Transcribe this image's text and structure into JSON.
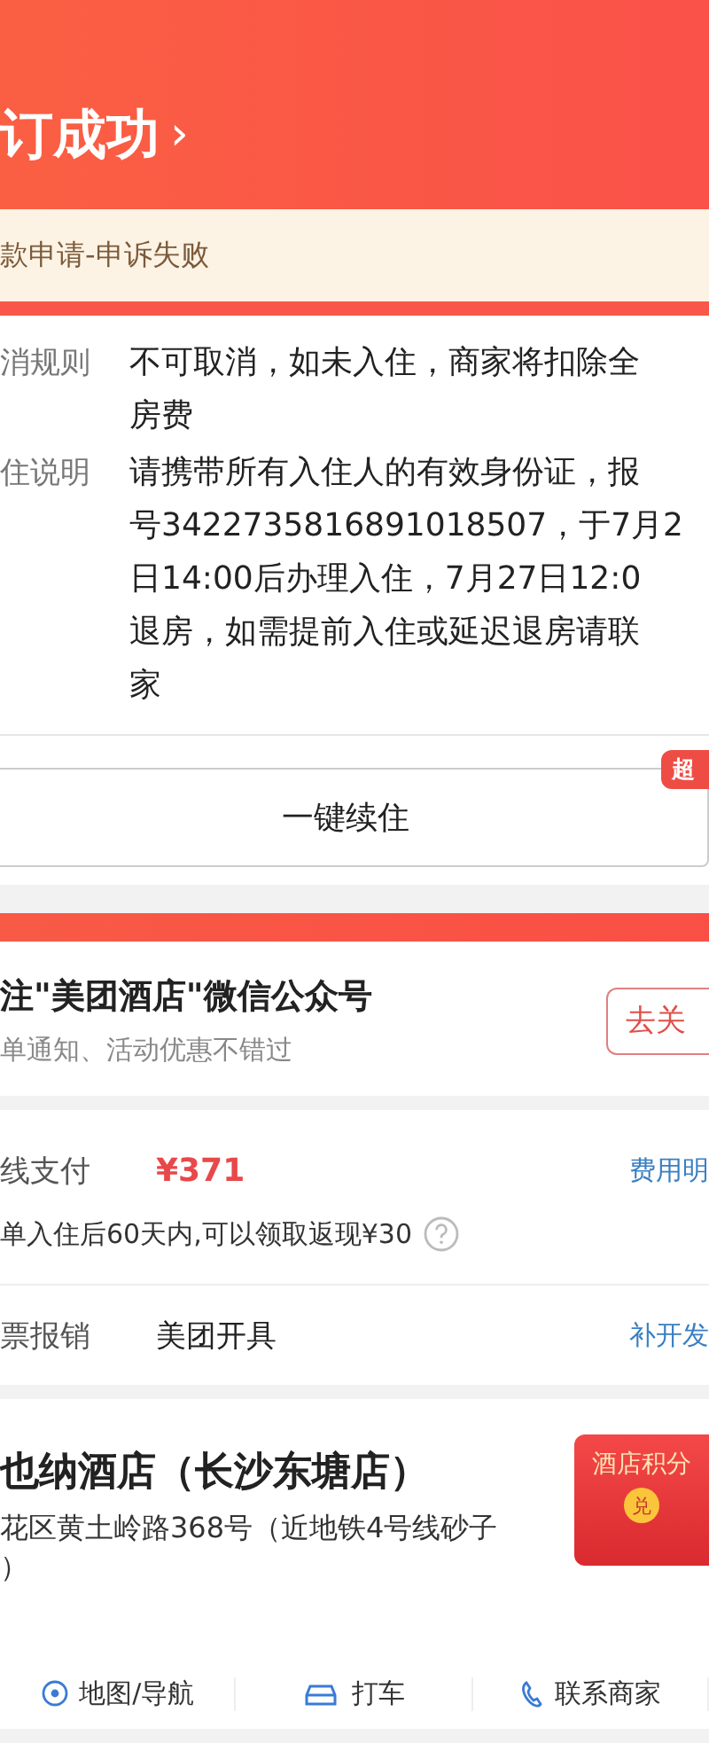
{
  "header": {
    "title": "订成功",
    "chevron": "›"
  },
  "notice": {
    "text": "款申请-申诉失败"
  },
  "rules": [
    {
      "label": "消规则",
      "lines": [
        "不可取消，如未入住，商家将扣除全",
        "房费"
      ]
    },
    {
      "label": "住说明",
      "lines": [
        "请携带所有入住人的有效身份证，报",
        "号3422735816891018507，于7月2",
        "日14:00后办理入住，7月27日12:0",
        "退房，如需提前入住或延迟退房请联",
        "家"
      ]
    }
  ],
  "extend": {
    "label": "一键续住",
    "badge": "超"
  },
  "follow": {
    "title": "注\"美团酒店\"微信公众号",
    "subtitle": "单通知、活动优惠不错过",
    "button": "去关"
  },
  "payment": {
    "label": "线支付",
    "amount": "¥371",
    "link": "费用明",
    "cashback": "单入住后60天内,可以领取返现¥30"
  },
  "invoice": {
    "label": "票报销",
    "value": "美团开具",
    "link": "补开发"
  },
  "hotel": {
    "name": "也纳酒店（长沙东塘店）",
    "address": [
      "花区黄土岭路368号（近地铁4号线砂子",
      "）"
    ],
    "reward": {
      "title": "酒店积分",
      "badge": "兑"
    }
  },
  "actions": [
    {
      "kind": "map",
      "label": "地图/导航"
    },
    {
      "kind": "taxi",
      "label": "打车"
    },
    {
      "kind": "phone",
      "label": "联系商家"
    }
  ]
}
